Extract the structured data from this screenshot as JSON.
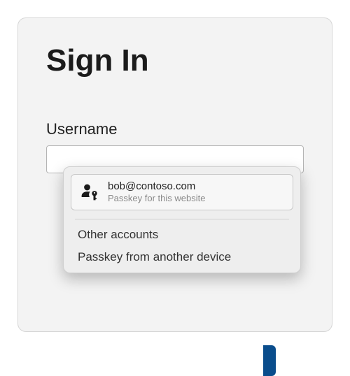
{
  "signin": {
    "title": "Sign In",
    "username_label": "Username",
    "username_value": ""
  },
  "passkey_popup": {
    "account": {
      "email": "bob@contoso.com",
      "subtitle": "Passkey for this website",
      "icon": "person-key-icon"
    },
    "other_accounts_label": "Other accounts",
    "another_device_label": "Passkey from another device"
  }
}
